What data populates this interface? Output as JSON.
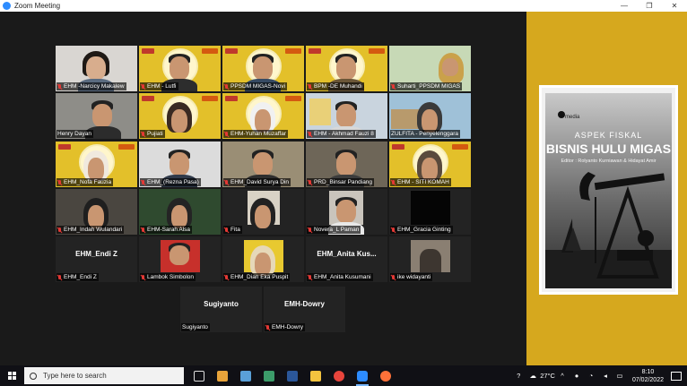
{
  "window": {
    "title": "Zoom Meeting",
    "minimize": "—",
    "maximize": "❐",
    "close": "✕"
  },
  "participants": [
    {
      "name": "EHM -Narcicy Makalew",
      "muted": true
    },
    {
      "name": "EHM - Lutfi",
      "muted": true
    },
    {
      "name": "PPSDM MIGAS-Novi",
      "muted": true
    },
    {
      "name": "BPM -DE Muhandi",
      "muted": true
    },
    {
      "name": "Suharti_PPSDM MIGAS",
      "muted": true
    },
    {
      "name": "Henry Dayan",
      "muted": false
    },
    {
      "name": "Pujiati",
      "muted": true
    },
    {
      "name": "EHM-Yuhan Muzaffar",
      "muted": true
    },
    {
      "name": "EHM - Akhmad Fauzi 8",
      "muted": true
    },
    {
      "name": "ZULFITA - Penyelenggara",
      "muted": false
    },
    {
      "name": "EHM_Nofa Fauzia",
      "muted": true
    },
    {
      "name": "EHM_(Rezna Pasa)",
      "muted": true
    },
    {
      "name": "EHM_David Surya Din",
      "muted": true
    },
    {
      "name": "PRD_Binsar Pandiang",
      "muted": true
    },
    {
      "name": "EHM - SITI KOMAH",
      "muted": true
    },
    {
      "name": "EHM_Indah Wulandari",
      "muted": true
    },
    {
      "name": "EHM-Sarah Alsa",
      "muted": true
    },
    {
      "name": "Fita",
      "muted": true
    },
    {
      "name": "Novera_L Paman",
      "muted": true
    },
    {
      "name": "EHM_Gracia Ginting",
      "muted": true
    },
    {
      "name": "EHM_Endi Z",
      "muted": true,
      "big": "EHM_Endi Z"
    },
    {
      "name": "Lambok Simbolon",
      "muted": true
    },
    {
      "name": "EHM_Dian Eka Puspit",
      "muted": true
    },
    {
      "name": "EHM_Anita Kusumani",
      "muted": true,
      "big": "EHM_Anita Kus..."
    },
    {
      "name": "ike widayanti",
      "muted": true
    },
    {
      "name": "Sugiyanto",
      "muted": false,
      "big": "Sugiyanto"
    },
    {
      "name": "EMH-Dowry",
      "muted": true,
      "big": "EMH-Dowry"
    }
  ],
  "shared_screen": {
    "publisher": "media",
    "title_small": "ASPEK FISKAL",
    "title_big": "BISNIS HULU MIGAS",
    "editor": "Editor : Rolyanto Kurniawan & Hidayat Amir"
  },
  "taskbar": {
    "search_placeholder": "Type here to search",
    "weather": "27°C",
    "time": "8:10",
    "date": "07/02/2022",
    "colors": {
      "zoom": "#2d8cff",
      "word": "#2b579a",
      "chrome": "#e8453c",
      "firefox": "#ff7139",
      "explorer": "#f3c33f"
    }
  }
}
